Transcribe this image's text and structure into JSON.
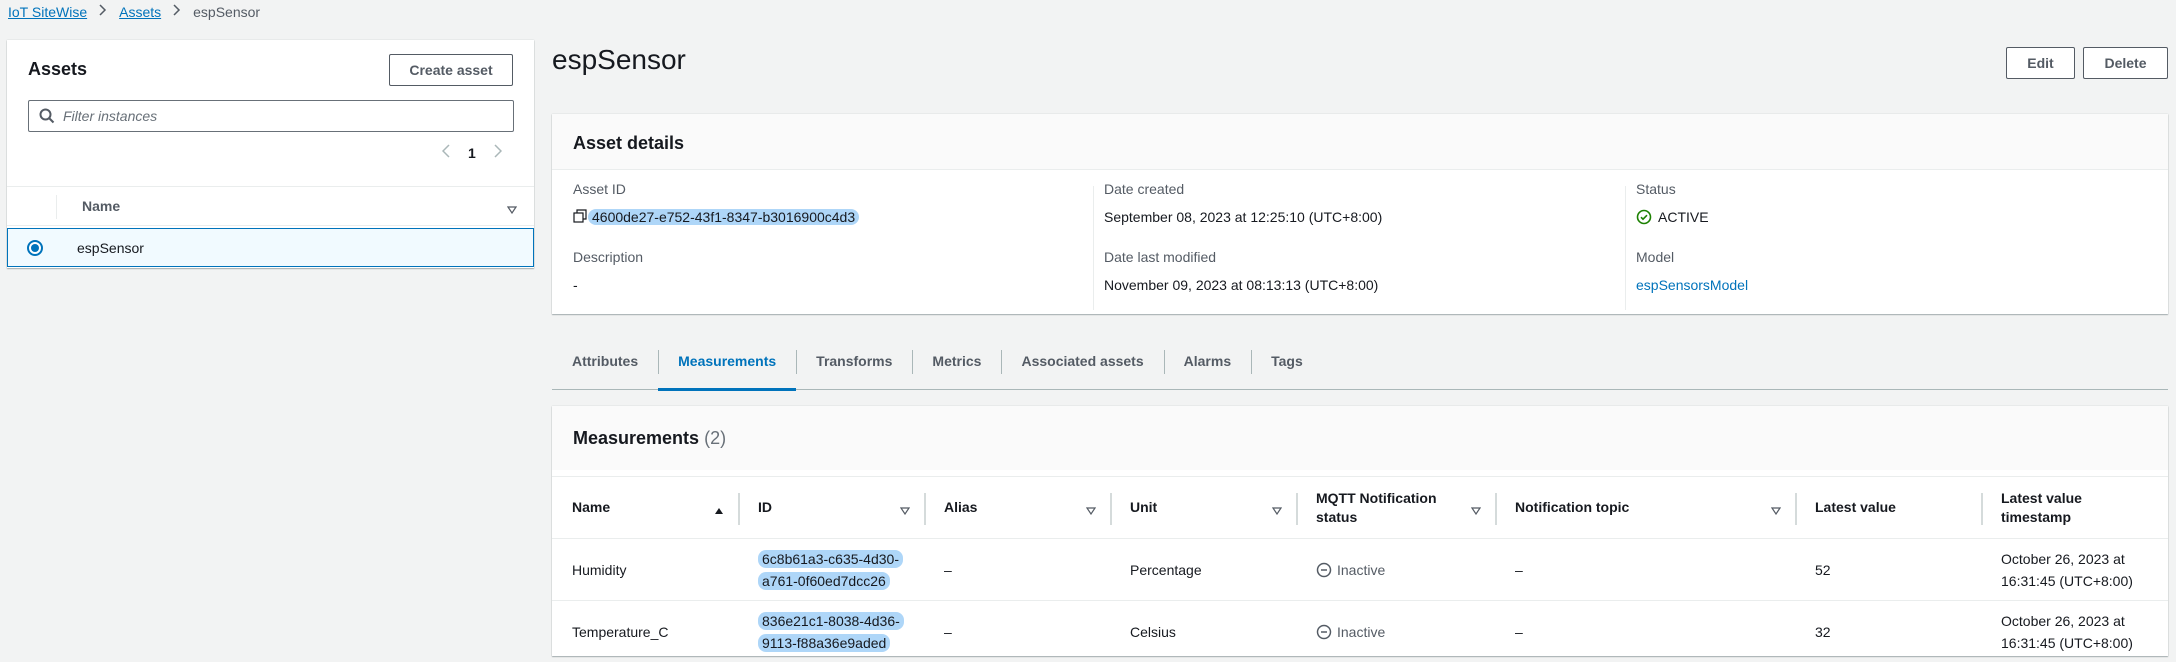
{
  "breadcrumb": {
    "root": "IoT SiteWise",
    "assets": "Assets",
    "current": "espSensor"
  },
  "assets_panel": {
    "title": "Assets",
    "create_button": "Create asset",
    "filter_placeholder": "Filter instances",
    "page": "1",
    "column_name": "Name",
    "rows": [
      {
        "name": "espSensor",
        "selected": true
      }
    ]
  },
  "page": {
    "title": "espSensor",
    "edit_button": "Edit",
    "delete_button": "Delete"
  },
  "asset_details": {
    "title": "Asset details",
    "asset_id_label": "Asset ID",
    "asset_id": "4600de27-e752-43f1-8347-b3016900c4d3",
    "description_label": "Description",
    "description": "-",
    "date_created_label": "Date created",
    "date_created": "September 08, 2023 at 12:25:10 (UTC+8:00)",
    "date_modified_label": "Date last modified",
    "date_modified": "November 09, 2023 at 08:13:13 (UTC+8:00)",
    "status_label": "Status",
    "status": "ACTIVE",
    "model_label": "Model",
    "model": "espSensorsModel"
  },
  "tabs": [
    "Attributes",
    "Measurements",
    "Transforms",
    "Metrics",
    "Associated assets",
    "Alarms",
    "Tags"
  ],
  "active_tab": "Measurements",
  "measurements": {
    "title": "Measurements",
    "count": "(2)",
    "columns": [
      "Name",
      "ID",
      "Alias",
      "Unit",
      "MQTT Notification status",
      "Notification topic",
      "Latest value",
      "Latest value timestamp"
    ],
    "rows": [
      {
        "name": "Humidity",
        "id": "6c8b61a3-c635-4d30-a761-0f60ed7dcc26",
        "alias": "–",
        "unit": "Percentage",
        "mqtt": "Inactive",
        "topic": "–",
        "latest": "52",
        "timestamp": "October 26, 2023 at 16:31:45 (UTC+8:00)"
      },
      {
        "name": "Temperature_C",
        "id": "836e21c1-8038-4d36-9113-f88a36e9aded",
        "alias": "–",
        "unit": "Celsius",
        "mqtt": "Inactive",
        "topic": "–",
        "latest": "32",
        "timestamp": "October 26, 2023 at 16:31:45 (UTC+8:00)"
      }
    ]
  },
  "colors": {
    "link": "#0073bb",
    "active_status": "#1d8102",
    "selection_bg": "#f1faff",
    "highlight": "#aed6f8"
  },
  "icons": [
    "chevron-right-icon",
    "search-icon",
    "chevron-left-icon",
    "sort-down-icon",
    "copy-icon",
    "check-circle-icon",
    "sort-up-icon",
    "minus-circle-icon"
  ]
}
